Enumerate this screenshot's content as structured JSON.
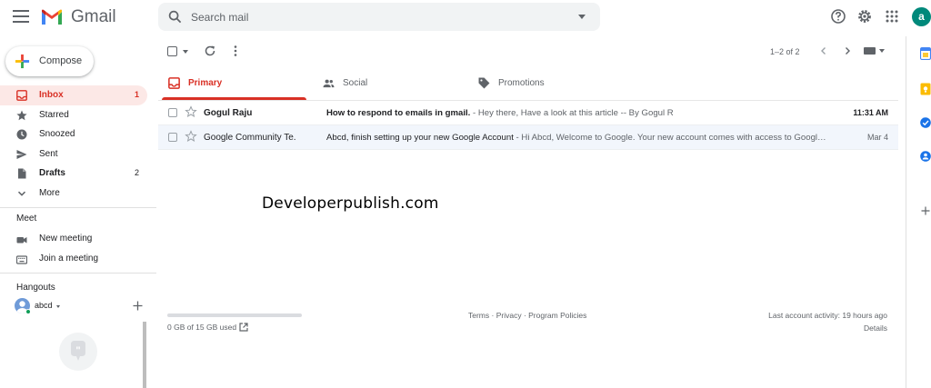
{
  "header": {
    "app_name": "Gmail",
    "search_placeholder": "Search mail",
    "avatar_letter": "a",
    "avatar_color": "#00897b"
  },
  "sidebar": {
    "compose_label": "Compose",
    "items": [
      {
        "label": "Inbox",
        "count": "1",
        "icon": "inbox-icon",
        "active": true
      },
      {
        "label": "Starred",
        "count": "",
        "icon": "star-icon"
      },
      {
        "label": "Snoozed",
        "count": "",
        "icon": "clock-icon"
      },
      {
        "label": "Sent",
        "count": "",
        "icon": "send-icon"
      },
      {
        "label": "Drafts",
        "count": "2",
        "icon": "draft-icon"
      },
      {
        "label": "More",
        "count": "",
        "icon": "chevron-down-icon"
      }
    ],
    "meet": {
      "title": "Meet",
      "items": [
        {
          "label": "New meeting",
          "icon": "video-camera-icon"
        },
        {
          "label": "Join a meeting",
          "icon": "keyboard-icon"
        }
      ]
    },
    "hangouts": {
      "title": "Hangouts",
      "user": "abcd"
    }
  },
  "toolbar": {
    "pagination": "1–2 of 2"
  },
  "tabs": [
    {
      "label": "Primary",
      "icon": "inbox-icon",
      "active": true
    },
    {
      "label": "Social",
      "icon": "people-icon"
    },
    {
      "label": "Promotions",
      "icon": "tag-icon"
    }
  ],
  "emails": [
    {
      "sender": "Gogul Raju",
      "subject": "How to respond to emails in gmail.",
      "snippet": " - Hey there, Have a look at this article -- By Gogul R",
      "time": "11:31 AM",
      "unread": true
    },
    {
      "sender": "Google Community Te.",
      "subject": "Abcd, finish setting up your new Google Account",
      "snippet": " - Hi Abcd, Welcome to Google. Your new account comes with access to Googl…",
      "time": "Mar 4",
      "unread": false
    }
  ],
  "watermark": "Developerpublish.com",
  "footer": {
    "storage": "0 GB of 15 GB used",
    "storage_used_fraction": 0,
    "terms": "Terms",
    "privacy": "Privacy",
    "policies": "Program Policies",
    "separator": " · ",
    "activity": "Last account activity: 19 hours ago",
    "details": "Details"
  },
  "colors": {
    "accent_red": "#d93025",
    "active_bg": "#fce8e6",
    "read_row_bg": "#f2f6fc"
  }
}
